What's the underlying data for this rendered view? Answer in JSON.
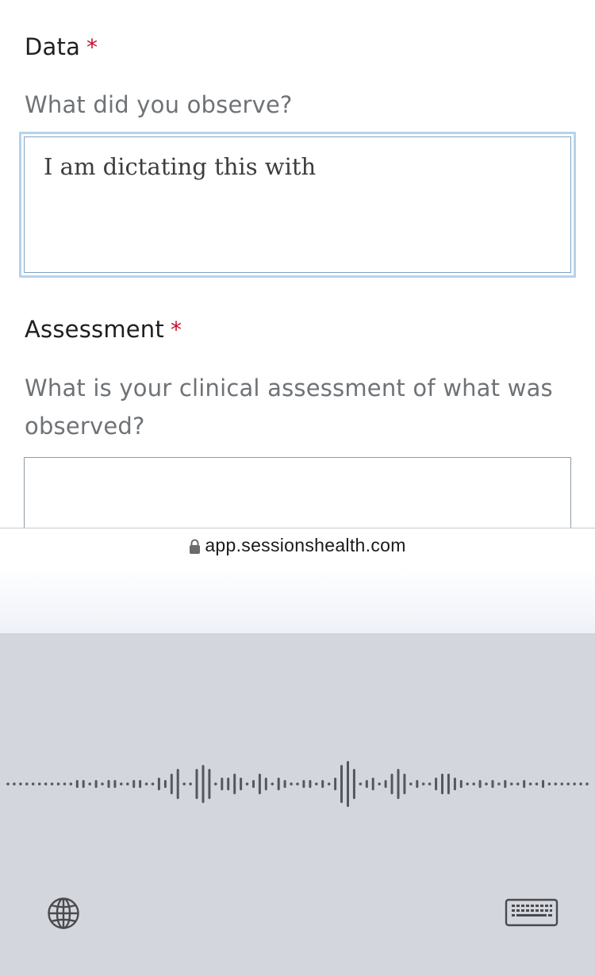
{
  "form": {
    "data_field": {
      "label": "Data",
      "required_marker": "*",
      "help_text": "What did you observe?",
      "value": "I am dictating this with"
    },
    "assessment_field": {
      "label": "Assessment",
      "required_marker": "*",
      "help_text": "What is your clinical assessment of what was observed?",
      "value": ""
    }
  },
  "browser": {
    "url": "app.sessionshealth.com",
    "secure_icon": "lock-icon"
  },
  "dictation": {
    "left_control_icon": "globe-icon",
    "right_control_icon": "keyboard-icon",
    "waveform_levels": [
      0,
      0,
      0,
      0,
      0,
      0,
      0,
      0,
      0,
      0,
      0,
      1,
      1,
      0,
      1,
      0,
      1,
      1,
      0,
      0,
      1,
      1,
      0,
      0,
      2,
      1,
      3,
      4,
      0,
      0,
      4,
      5,
      4,
      0,
      2,
      2,
      3,
      2,
      0,
      1,
      3,
      2,
      0,
      2,
      1,
      0,
      0,
      1,
      1,
      0,
      1,
      0,
      2,
      5,
      6,
      4,
      0,
      1,
      2,
      0,
      1,
      3,
      4,
      3,
      0,
      1,
      0,
      0,
      2,
      3,
      3,
      2,
      1,
      0,
      0,
      1,
      0,
      1,
      0,
      1,
      0,
      0,
      1,
      0,
      0,
      1,
      0,
      0,
      0,
      0,
      0,
      0,
      0
    ]
  },
  "colors": {
    "required": "#c8102e",
    "focus_ring": "#b5d3ec",
    "dictation_bg": "#d3d6dd",
    "wave": "#55575c"
  }
}
